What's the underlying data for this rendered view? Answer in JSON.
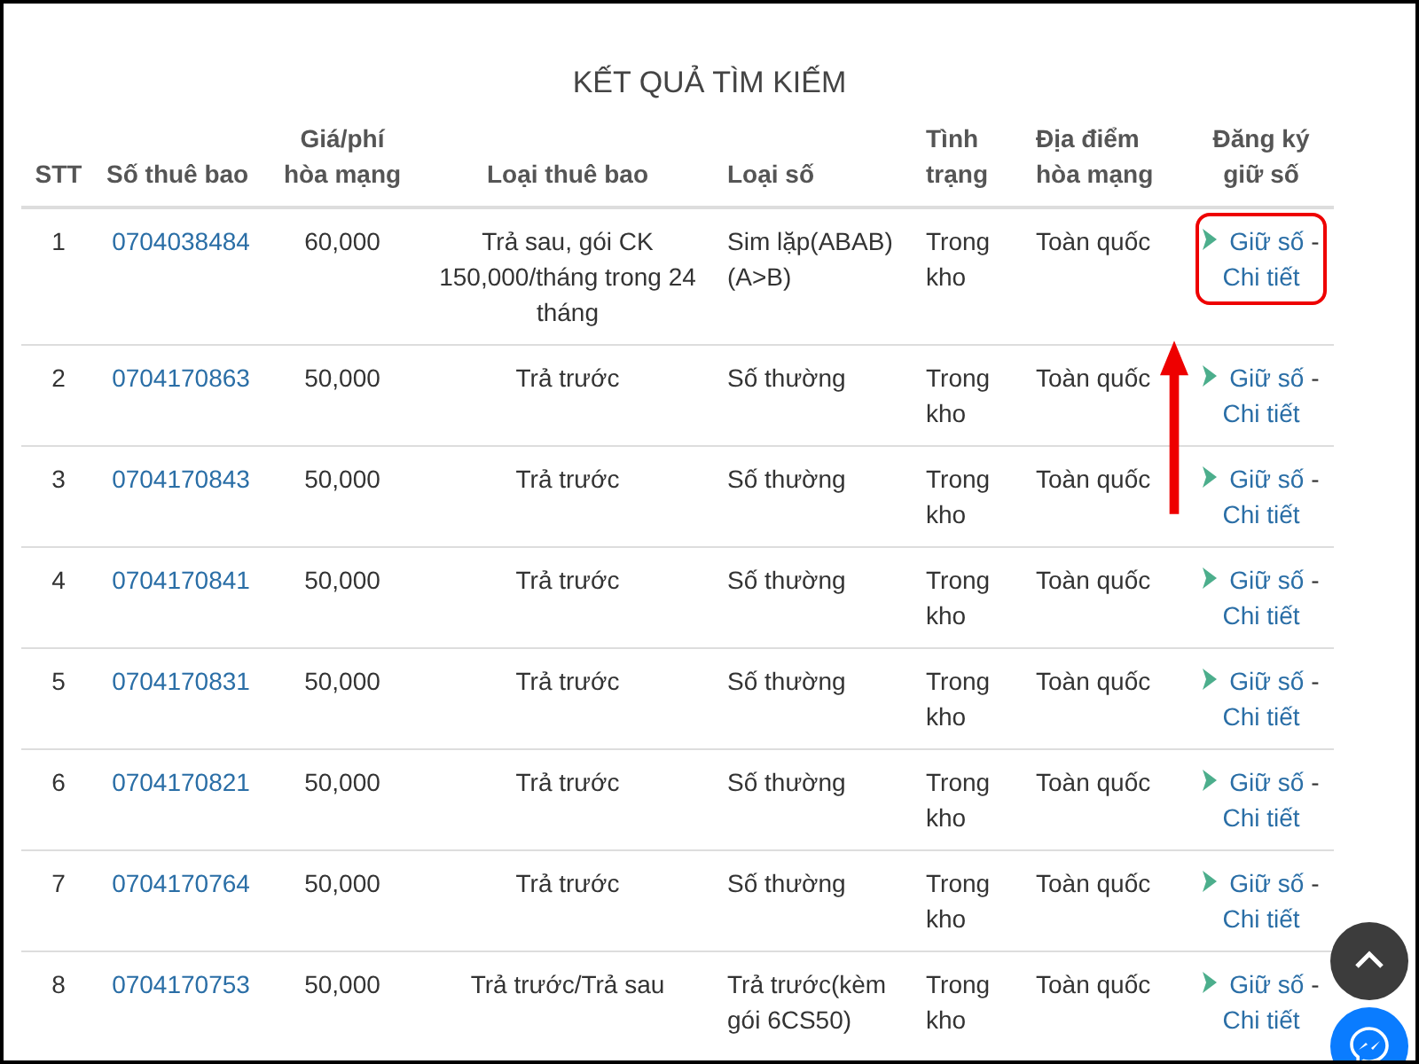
{
  "title": "KẾT QUẢ TÌM KIẾM",
  "columns": [
    "STT",
    "Số thuê bao",
    "Giá/phí hòa mạng",
    "Loại thuê bao",
    "Loại số",
    "Tình trạng",
    "Địa điểm hòa mạng",
    "Đăng ký giữ số"
  ],
  "rows": [
    {
      "stt": "1",
      "number": "0704038484",
      "price": "60,000",
      "subscription": "Trả sau, gói CK 150,000/tháng trong 24 tháng",
      "number_type": "Sim lặp(ABAB)(A>B)",
      "status": "Trong kho",
      "location": "Toàn quốc",
      "keep": "Giữ số",
      "separator": "-",
      "detail": "Chi tiết",
      "highlighted": true
    },
    {
      "stt": "2",
      "number": "0704170863",
      "price": "50,000",
      "subscription": "Trả trước",
      "number_type": "Số thường",
      "status": "Trong kho",
      "location": "Toàn quốc",
      "keep": "Giữ số",
      "separator": "-",
      "detail": "Chi tiết",
      "highlighted": false
    },
    {
      "stt": "3",
      "number": "0704170843",
      "price": "50,000",
      "subscription": "Trả trước",
      "number_type": "Số thường",
      "status": "Trong kho",
      "location": "Toàn quốc",
      "keep": "Giữ số",
      "separator": "-",
      "detail": "Chi tiết",
      "highlighted": false
    },
    {
      "stt": "4",
      "number": "0704170841",
      "price": "50,000",
      "subscription": "Trả trước",
      "number_type": "Số thường",
      "status": "Trong kho",
      "location": "Toàn quốc",
      "keep": "Giữ số",
      "separator": "-",
      "detail": "Chi tiết",
      "highlighted": false
    },
    {
      "stt": "5",
      "number": "0704170831",
      "price": "50,000",
      "subscription": "Trả trước",
      "number_type": "Số thường",
      "status": "Trong kho",
      "location": "Toàn quốc",
      "keep": "Giữ số",
      "separator": "-",
      "detail": "Chi tiết",
      "highlighted": false
    },
    {
      "stt": "6",
      "number": "0704170821",
      "price": "50,000",
      "subscription": "Trả trước",
      "number_type": "Số thường",
      "status": "Trong kho",
      "location": "Toàn quốc",
      "keep": "Giữ số",
      "separator": "-",
      "detail": "Chi tiết",
      "highlighted": false
    },
    {
      "stt": "7",
      "number": "0704170764",
      "price": "50,000",
      "subscription": "Trả trước",
      "number_type": "Số thường",
      "status": "Trong kho",
      "location": "Toàn quốc",
      "keep": "Giữ số",
      "separator": "-",
      "detail": "Chi tiết",
      "highlighted": false
    },
    {
      "stt": "8",
      "number": "0704170753",
      "price": "50,000",
      "subscription": "Trả trước/Trả sau",
      "number_type": "Trả trước(kèm gói 6CS50)",
      "status": "Trong kho",
      "location": "Toàn quốc",
      "keep": "Giữ số",
      "separator": "-",
      "detail": "Chi tiết",
      "highlighted": false
    }
  ],
  "floating_buttons": [
    {
      "kind": "scroll-top"
    },
    {
      "kind": "messenger"
    }
  ]
}
